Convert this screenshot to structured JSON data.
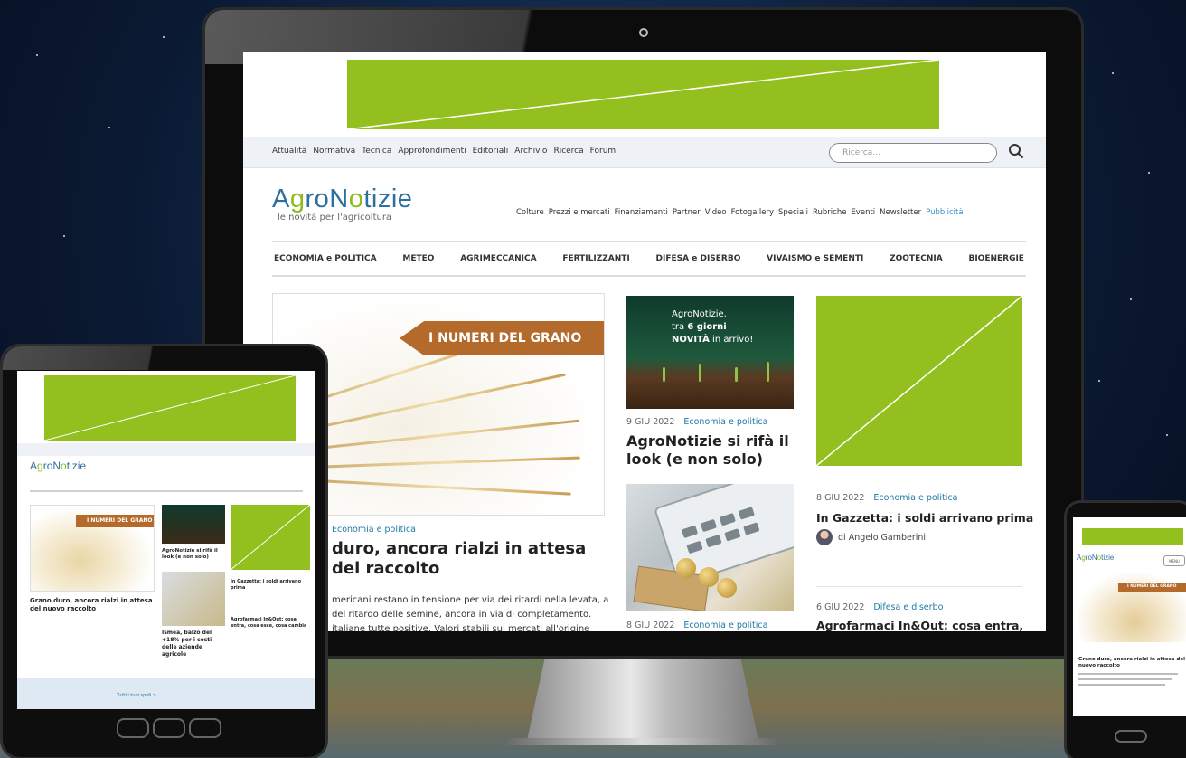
{
  "monitor": {
    "topnav": [
      "Attualità",
      "Normativa",
      "Tecnica",
      "Approfondimenti",
      "Editoriali",
      "Archivio",
      "Ricerca",
      "Forum"
    ],
    "search_placeholder": "Ricerca...",
    "logo": {
      "name_a": "AgroNotizie",
      "tagline": "le novità per l'agricoltura"
    },
    "mainnav": [
      "Colture",
      "Prezzi e mercati",
      "Finanziamenti",
      "Partner",
      "Video",
      "Fotogallery",
      "Speciali",
      "Rubriche",
      "Eventi",
      "Newsletter"
    ],
    "mainnav_highlight": "Pubblicità",
    "categories": [
      "ECONOMIA e POLITICA",
      "METEO",
      "AGRIMECCANICA",
      "FERTILIZZANTI",
      "DIFESA e DISERBO",
      "VIVAISMO e SEMENTI",
      "ZOOTECNIA",
      "BIOENERGIE"
    ],
    "featured": {
      "banner": "I NUMERI DEL GRANO",
      "category": "Economia e politica",
      "title": "duro, ancora rialzi in attesa del raccolto",
      "excerpt": "mericani restano in tensione per via dei ritardi nella levata, a del ritardo delle semine, ancora in via di completamento. italiane tutte positive. Valori stabili sui mercati all'origine"
    },
    "mid": {
      "promo_line1": "AgroNotizie,",
      "promo_line2": "tra",
      "promo_days": "6 giorni",
      "promo_new": "NOVITÀ",
      "promo_arrive": "in arrivo!",
      "item1": {
        "date": "9 GIU 2022",
        "category": "Economia e politica",
        "title": "AgroNotizie si rifà il look (e non solo)"
      },
      "item2": {
        "date": "8 GIU 2022",
        "category": "Economia e politica"
      }
    },
    "right": {
      "item1": {
        "date": "8 GIU 2022",
        "category": "Economia e politica",
        "title": "In Gazzetta: i soldi arrivano prima",
        "author": "di Angelo Gamberini"
      },
      "item2": {
        "date": "6 GIU 2022",
        "category": "Difesa e diserbo",
        "title": "Agrofarmaci In&Out: cosa entra,"
      }
    }
  },
  "tablet": {
    "logo": "AgroNotizie",
    "banner": "I NUMERI DEL GRANO",
    "feat_title": "Grano duro, ancora rialzi in attesa del nuovo raccolto",
    "mid1_title": "AgroNotizie si rifà il look (e non solo)",
    "mid2_title": "Ismea, balzo del +18% per i costi delle aziende agricole",
    "right1_title": "In Gazzetta: i soldi arrivano prima",
    "right2_title": "Agrofarmaci In&Out: cosa entra, cosa esce, cosa cambia",
    "strip_link": "Tutti i tuoi spidi >"
  },
  "phone": {
    "logo": "AgroNotizie",
    "menu": "MENU",
    "banner": "I NUMERI DEL GRANO",
    "title": "Grano duro, ancora rialzi in attesa del nuovo raccolto"
  },
  "colors": {
    "ad_green": "#93c01f",
    "brand_blue": "#2d6f9f",
    "link_blue": "#1e78a6",
    "grain_brown": "#b36a2a"
  }
}
